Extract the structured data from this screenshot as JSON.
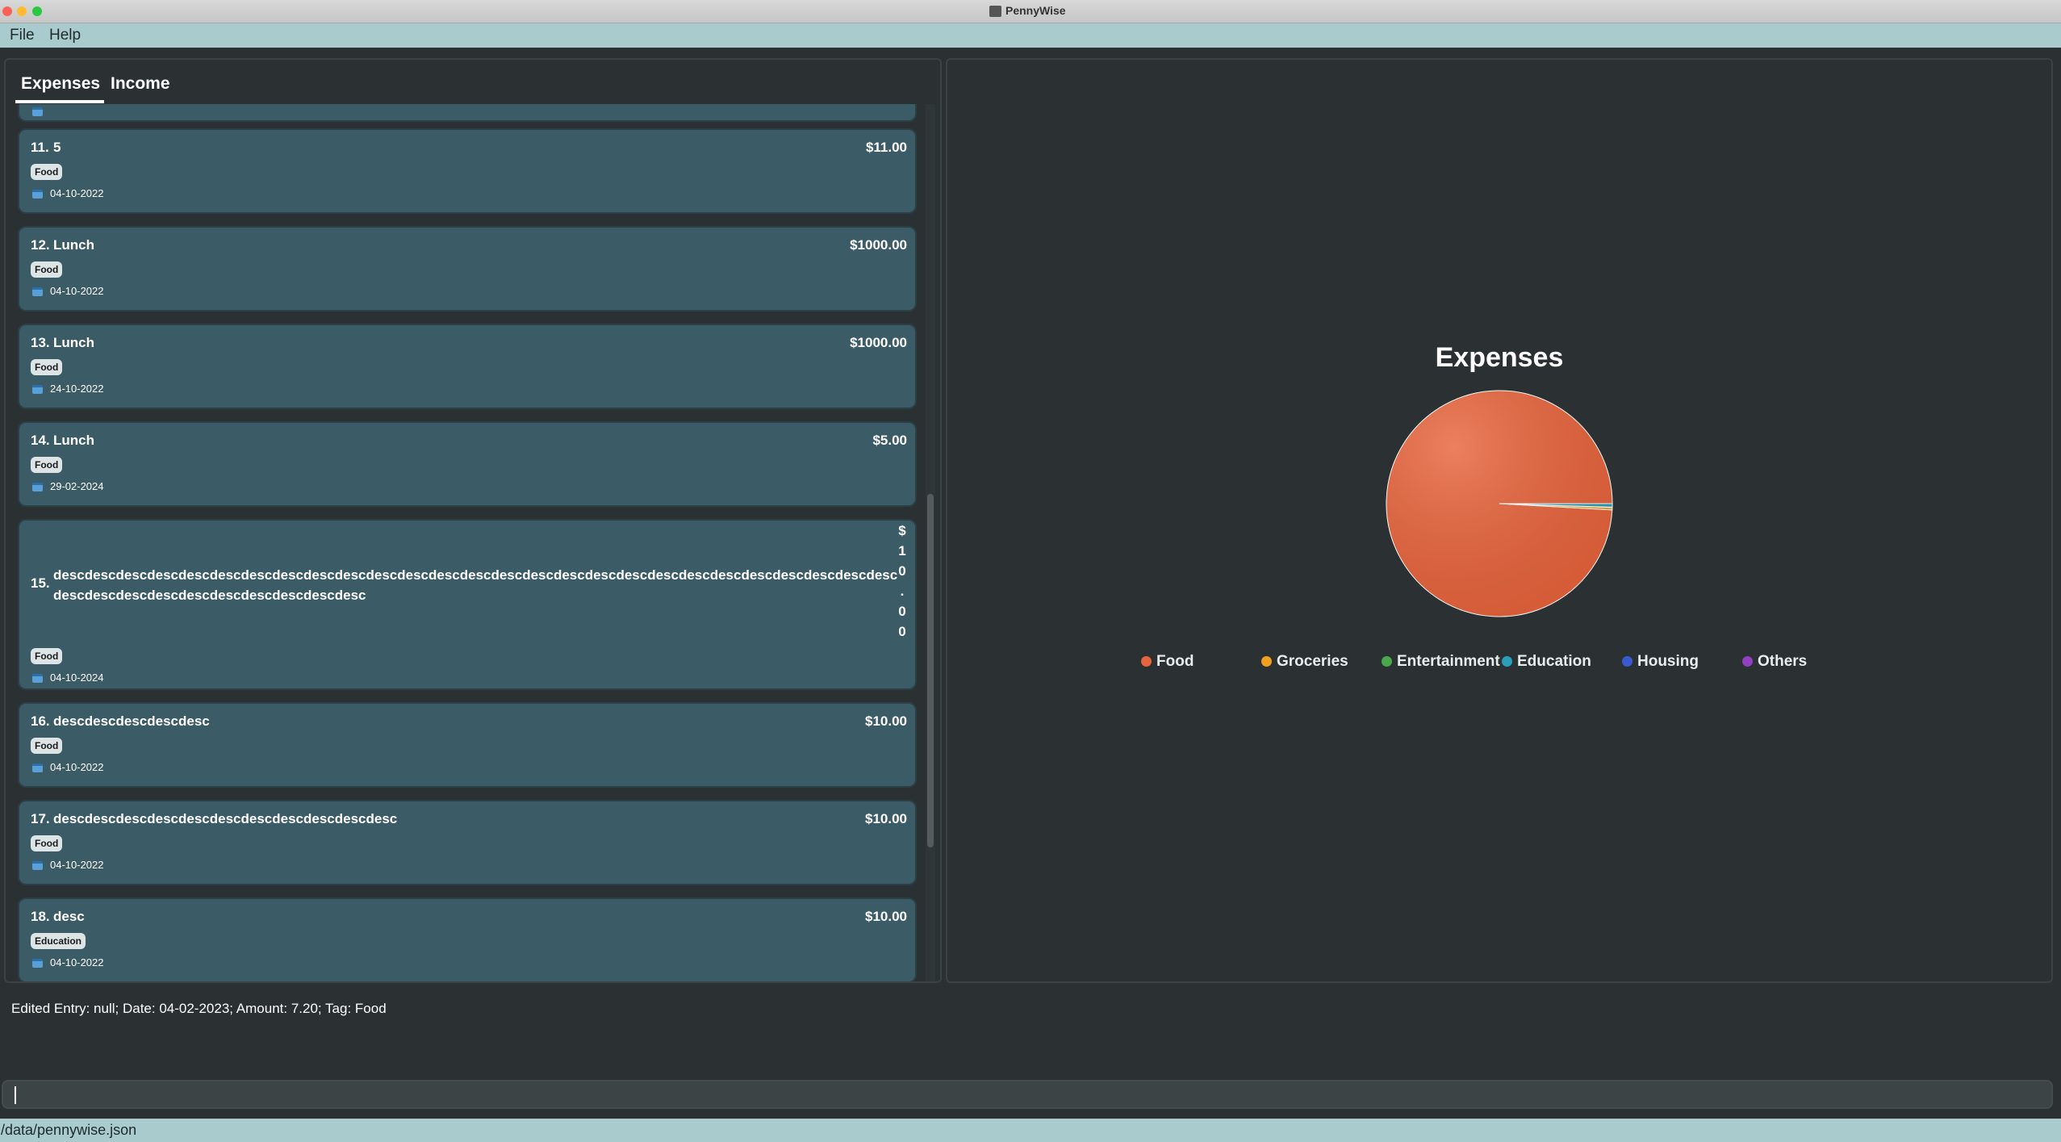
{
  "window": {
    "title": "PennyWise"
  },
  "menu": {
    "file": "File",
    "help": "Help"
  },
  "tabs": {
    "expenses": "Expenses",
    "income": "Income"
  },
  "entries": [
    {
      "index": "11.",
      "description": "5",
      "amount": "$11.00",
      "tag": "Food",
      "date": "04-10-2022"
    },
    {
      "index": "12.",
      "description": "Lunch",
      "amount": "$1000.00",
      "tag": "Food",
      "date": "04-10-2022"
    },
    {
      "index": "13.",
      "description": "Lunch",
      "amount": "$1000.00",
      "tag": "Food",
      "date": "24-10-2022"
    },
    {
      "index": "14.",
      "description": "Lunch",
      "amount": "$5.00",
      "tag": "Food",
      "date": "29-02-2024"
    },
    {
      "index": "15.",
      "description": "descdescdescdescdescdescdescdescdescdescdescdescdescdescdescdescdescdescdescdescdescdescdescdescdescdescdescdescdescdescdescdescdescdescdescdescdesc",
      "amount": "$10.00",
      "amount_chars": [
        "$",
        "1",
        "0",
        ".",
        "0",
        "0"
      ],
      "tag": "Food",
      "date": "04-10-2024"
    },
    {
      "index": "16.",
      "description": "descdescdescdescdesc",
      "amount": "$10.00",
      "tag": "Food",
      "date": "04-10-2022"
    },
    {
      "index": "17.",
      "description": "descdescdescdescdescdescdescdescdescdescdesc",
      "amount": "$10.00",
      "tag": "Food",
      "date": "04-10-2022"
    },
    {
      "index": "18.",
      "description": "desc",
      "amount": "$10.00",
      "tag": "Education",
      "date": "04-10-2022"
    }
  ],
  "chart_data": {
    "type": "pie",
    "title": "Expenses",
    "categories": [
      "Food",
      "Groceries",
      "Entertainment",
      "Education",
      "Housing",
      "Others"
    ],
    "values": [
      2016.0,
      7.2,
      1.0,
      10.0,
      0,
      0
    ],
    "colors": [
      "#e8643c",
      "#f0a020",
      "#4aa84a",
      "#2a9fb8",
      "#3a5ad0",
      "#9040c0"
    ],
    "legend_position": "bottom"
  },
  "result_message": "Edited Entry: null; Date: 04-02-2023; Amount: 7.20; Tag: Food",
  "command_box": {
    "value": ""
  },
  "status_bar": {
    "path": "/data/pennywise.json"
  }
}
